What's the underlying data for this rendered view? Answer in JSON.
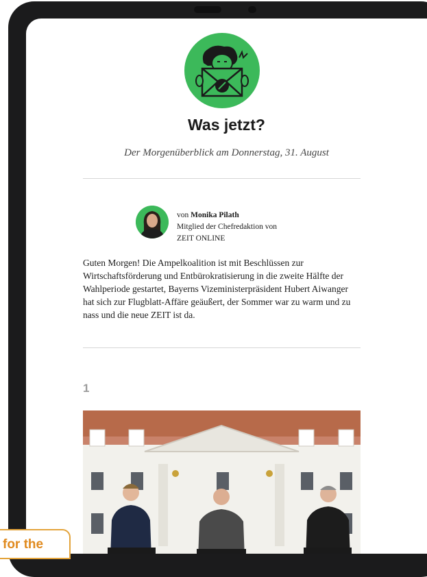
{
  "newsletter": {
    "title": "Was jetzt?",
    "subtitle": "Der Morgenüberblick am Donnerstag, 31. August"
  },
  "author": {
    "prefix": "von ",
    "name": "Monika Pilath",
    "role_line1": "Mitglied der Chefredaktion von",
    "role_line2": "ZEIT ONLINE"
  },
  "intro": "Guten Morgen! Die Ampelkoalition ist mit Beschlüssen zur Wirtschaftsförderung und Entbürokratisierung in die zweite Hälfte der Wahlperiode gestartet, Bayerns Vizeministerpräsident Hubert Aiwanger hat sich zur Flugblatt-Affäre geäußert, der Sommer war zu warm und zu nass und die neue ZEIT ist da.",
  "section": {
    "number": "1"
  },
  "overlay_badge": {
    "text": "for the"
  },
  "colors": {
    "brand_green": "#3cb95a",
    "accent_orange": "#e08a1e",
    "device_frame": "#1b1b1c"
  }
}
